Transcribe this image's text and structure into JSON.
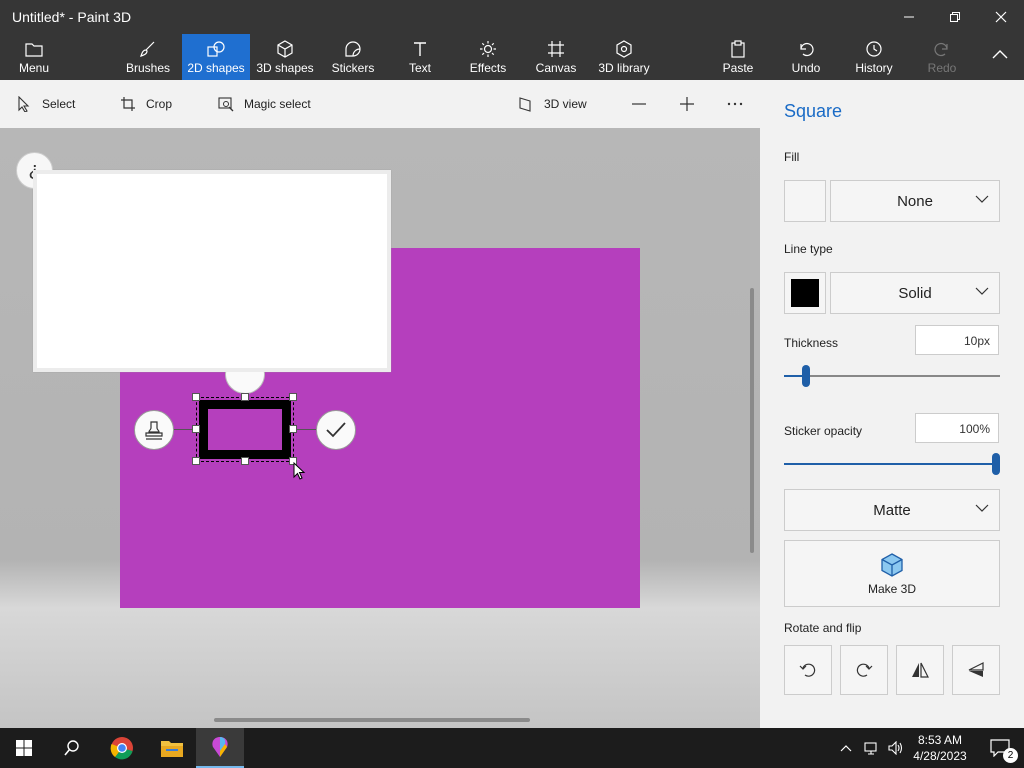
{
  "window": {
    "title": "Untitled* - Paint 3D"
  },
  "ribbon": {
    "menu": "Menu",
    "tabs": [
      "Brushes",
      "2D shapes",
      "3D shapes",
      "Stickers",
      "Text",
      "Effects",
      "Canvas",
      "3D library"
    ],
    "active_tab": "2D shapes",
    "paste": "Paste",
    "undo": "Undo",
    "history": "History",
    "redo": "Redo"
  },
  "toolbar": {
    "select": "Select",
    "crop": "Crop",
    "magic_select": "Magic select",
    "view_3d": "3D view"
  },
  "canvas": {
    "help_glyph": "¿",
    "canvas_color": "#b53fbd"
  },
  "panel": {
    "title": "Square",
    "fill_label": "Fill",
    "fill_value": "None",
    "line_type_label": "Line type",
    "line_type_value": "Solid",
    "line_color": "#000000",
    "thickness_label": "Thickness",
    "thickness_value": "10px",
    "thickness_fraction": 0.1,
    "sticker_opacity_label": "Sticker opacity",
    "sticker_opacity_value": "100%",
    "sticker_opacity_fraction": 1.0,
    "finish_value": "Matte",
    "make3d_label": "Make 3D",
    "rotate_flip_label": "Rotate and flip"
  },
  "taskbar": {
    "time": "8:53 AM",
    "date": "4/28/2023",
    "notification_count": "2"
  },
  "colors": {
    "accent": "#1f6fd0",
    "titlebar": "#363636",
    "panel_title": "#1a6bc6"
  }
}
